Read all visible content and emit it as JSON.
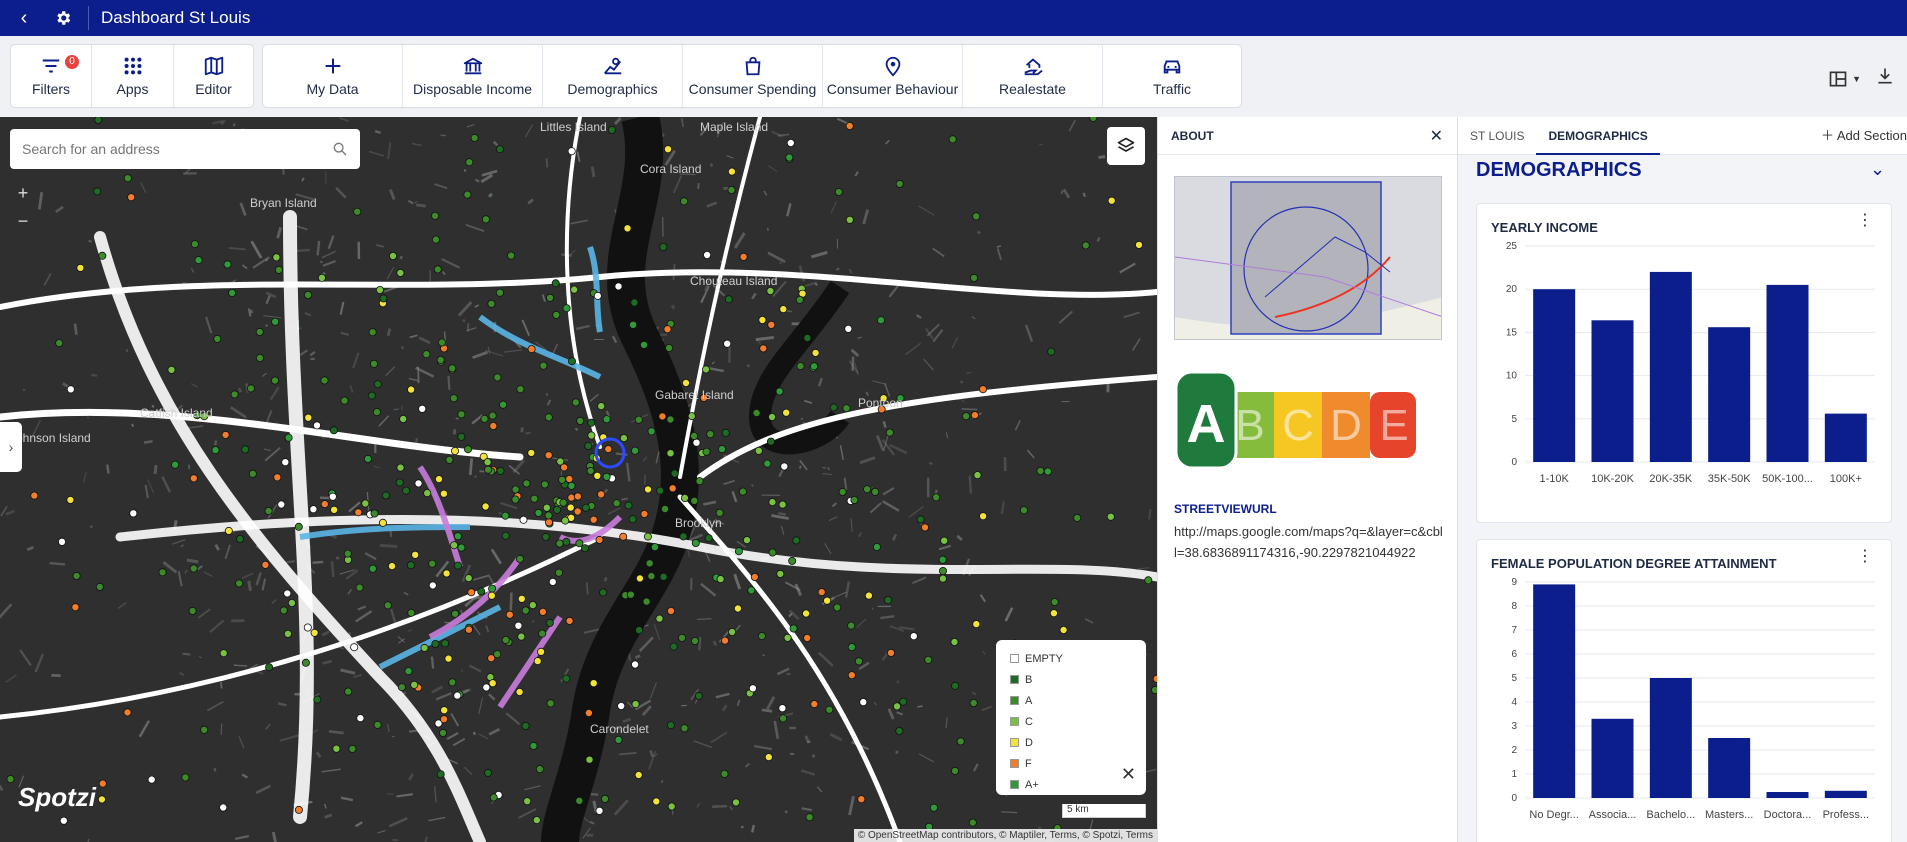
{
  "header": {
    "title": "Dashboard St Louis"
  },
  "toolbar": {
    "group1": [
      {
        "label": "Filters",
        "icon": "filter-icon",
        "badge": "0"
      },
      {
        "label": "Apps",
        "icon": "apps-grid-icon"
      },
      {
        "label": "Editor",
        "icon": "map-icon"
      }
    ],
    "group2": [
      {
        "label": "My Data",
        "icon": "plus-icon"
      },
      {
        "label": "Disposable Income",
        "icon": "bank-icon"
      },
      {
        "label": "Demographics",
        "icon": "demographics-chart-icon"
      },
      {
        "label": "Consumer Spending",
        "icon": "shopping-bag-icon"
      },
      {
        "label": "Consumer Behaviour",
        "icon": "location-brain-icon"
      },
      {
        "label": "Realestate",
        "icon": "house-hand-icon"
      },
      {
        "label": "Traffic",
        "icon": "car-icon"
      }
    ]
  },
  "map": {
    "search_placeholder": "Search for an address",
    "zoom_in": "+",
    "zoom_out": "−",
    "legend": [
      {
        "label": "EMPTY",
        "color": "#ffffff"
      },
      {
        "label": "B",
        "color": "#1e6b23"
      },
      {
        "label": "A",
        "color": "#3d8a2b"
      },
      {
        "label": "C",
        "color": "#7ac143"
      },
      {
        "label": "D",
        "color": "#f2e33b"
      },
      {
        "label": "F",
        "color": "#f27d2b"
      },
      {
        "label": "A+",
        "color": "#2f9a3a"
      }
    ],
    "logo": "Spotzi",
    "scale": "5 km",
    "attribution": "© OpenStreetMap contributors, © Maptiler, Terms, © Spotzi, Terms",
    "places": [
      "Littles Island",
      "Maple Island",
      "Cora Island",
      "Bryan Island",
      "Catfish Island",
      "Johnson Island",
      "Gabaret Island",
      "Chouteau Island",
      "Carondelet",
      "Brooklyn",
      "Pontoon"
    ]
  },
  "about": {
    "title": "ABOUT",
    "grades": [
      "A",
      "B",
      "C",
      "D",
      "E"
    ],
    "streetview_label": "STREETVIEWURL",
    "streetview_url": "http://maps.google.com/maps?q=&layer=c&cbll=38.6836891174316,-90.2297821044922"
  },
  "demographics": {
    "tabs": [
      "ST LOUIS",
      "DEMOGRAPHICS"
    ],
    "active_tab": 1,
    "add_section": "Add Section",
    "section_title": "DEMOGRAPHICS"
  },
  "chart_data": [
    {
      "type": "bar",
      "title": "YEARLY INCOME",
      "categories": [
        "1-10K",
        "10K-20K",
        "20K-35K",
        "35K-50K",
        "50K-100...",
        "100K+"
      ],
      "values": [
        20,
        16.4,
        22,
        15.6,
        20.5,
        5.6
      ],
      "ylim": [
        0,
        25
      ],
      "yticks": [
        0,
        5,
        10,
        15,
        20,
        25
      ],
      "color": "#0c1d8c",
      "grid": true
    },
    {
      "type": "bar",
      "title": "FEMALE POPULATION DEGREE ATTAINMENT",
      "categories": [
        "No Degr...",
        "Associa...",
        "Bachelo...",
        "Masters...",
        "Doctora...",
        "Profess..."
      ],
      "values": [
        8.9,
        3.3,
        5.0,
        2.5,
        0.25,
        0.3
      ],
      "ylim": [
        0,
        9
      ],
      "yticks": [
        0,
        1,
        2,
        3,
        4,
        5,
        6,
        7,
        8,
        9
      ],
      "color": "#0c1d8c",
      "grid": true
    }
  ]
}
